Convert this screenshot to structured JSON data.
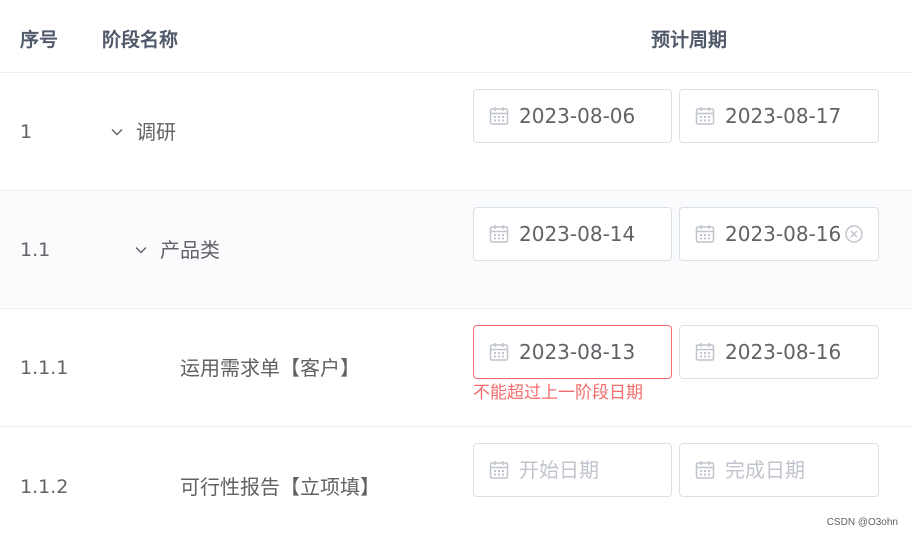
{
  "table": {
    "headers": {
      "index": "序号",
      "name": "阶段名称",
      "period": "预计周期"
    },
    "rows": [
      {
        "index": "1",
        "name": "调研",
        "expandable": true,
        "start": {
          "value": "2023-08-06",
          "placeholder": "开始日期"
        },
        "end": {
          "value": "2023-08-17",
          "placeholder": "完成日期"
        }
      },
      {
        "index": "1.1",
        "name": "产品类",
        "expandable": true,
        "start": {
          "value": "2023-08-14",
          "placeholder": "开始日期"
        },
        "end": {
          "value": "2023-08-16",
          "placeholder": "完成日期",
          "show_clear": true
        }
      },
      {
        "index": "1.1.1",
        "name": "运用需求单【客户】",
        "expandable": false,
        "start": {
          "value": "2023-08-13",
          "placeholder": "开始日期",
          "error": true
        },
        "end": {
          "value": "2023-08-16",
          "placeholder": "完成日期"
        },
        "error_message": "不能超过上一阶段日期"
      },
      {
        "index": "1.1.2",
        "name": "可行性报告【立项填】",
        "expandable": false,
        "start": {
          "value": "",
          "placeholder": "开始日期"
        },
        "end": {
          "value": "",
          "placeholder": "完成日期"
        }
      }
    ]
  },
  "colors": {
    "error": "#f56c6c",
    "border": "#dcdfe6",
    "text": "#606266",
    "placeholder": "#c0c4cc",
    "header_text": "#505a6b",
    "stripe_bg": "#fafbfd"
  },
  "icons": {
    "calendar": "calendar-icon",
    "clear": "circle-close-icon",
    "expand": "chevron-down-icon"
  },
  "watermark": "CSDN @O3ohn"
}
